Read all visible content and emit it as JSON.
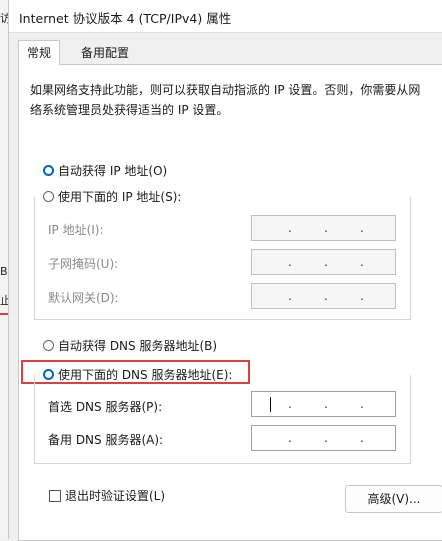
{
  "window": {
    "title": "Internet 协议版本 4 (TCP/IPv4) 属性"
  },
  "background": {
    "fragments": [
      "访",
      "B",
      "止"
    ]
  },
  "tabs": [
    {
      "label": "常规",
      "active": true
    },
    {
      "label": "备用配置",
      "active": false
    }
  ],
  "description": "如果网络支持此功能，则可以获取自动指派的 IP 设置。否则，你需要从网络系统管理员处获得适当的 IP 设置。",
  "ip_section": {
    "auto_label": "自动获得 IP 地址(O)",
    "auto_checked": true,
    "manual_label": "使用下面的 IP 地址(S):",
    "manual_checked": false,
    "fields": [
      {
        "label": "IP 地址(I):",
        "dots": [
          ".",
          ".",
          "."
        ]
      },
      {
        "label": "子网掩码(U):",
        "dots": [
          ".",
          ".",
          "."
        ]
      },
      {
        "label": "默认网关(D):",
        "dots": [
          ".",
          ".",
          "."
        ]
      }
    ]
  },
  "dns_section": {
    "auto_label": "自动获得 DNS 服务器地址(B)",
    "auto_checked": false,
    "manual_label": "使用下面的 DNS 服务器地址(E):",
    "manual_checked": true,
    "fields": [
      {
        "label": "首选 DNS 服务器(P):",
        "dots": [
          ".",
          ".",
          "."
        ]
      },
      {
        "label": "备用 DNS 服务器(A):",
        "dots": [
          ".",
          ".",
          "."
        ]
      }
    ]
  },
  "validate_label": "退出时验证设置(L)",
  "validate_checked": false,
  "advanced_button": "高级(V)...",
  "colors": {
    "accent": "#0067c0",
    "highlight": "#d94040"
  }
}
